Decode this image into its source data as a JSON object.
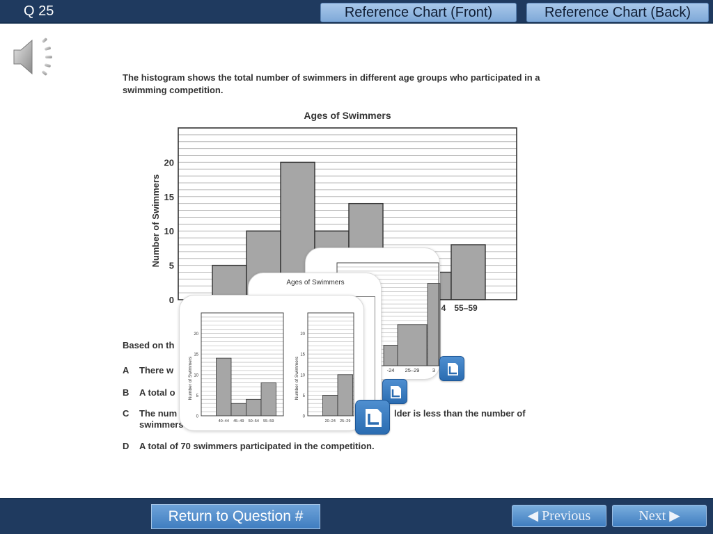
{
  "header": {
    "question_label": "Q 25",
    "ref_front_label": "Reference Chart (Front)",
    "ref_back_label": "Reference Chart (Back)"
  },
  "audio": {
    "icon": "speaker-icon"
  },
  "question": {
    "prompt": "The histogram shows the total number of swimmers in different age groups who participated in a swimming competition.",
    "stem_visible": "Based on th",
    "choices": [
      {
        "letter": "A",
        "fragments": [
          "There w"
        ]
      },
      {
        "letter": "B",
        "fragments": [
          "A total o"
        ]
      },
      {
        "letter": "C",
        "fragments": [
          "The num",
          "lder is less than the number of",
          "swimmers"
        ]
      },
      {
        "letter": "D",
        "fragments": [
          "A total of 70 swimmers participated in the competition."
        ]
      }
    ]
  },
  "chart_data": [
    {
      "type": "bar",
      "title": "Ages of Swimmers",
      "ylabel": "Number of Swimmers",
      "xlabel": "",
      "ylim": [
        0,
        25
      ],
      "yticks": [
        0,
        5,
        10,
        15,
        20
      ],
      "grid": true,
      "visible_categories": [
        "4",
        "55–59"
      ],
      "values": [
        5,
        10,
        20,
        10,
        14,
        5,
        4,
        8
      ]
    },
    {
      "type": "bar",
      "title": "",
      "ylabel": "Number of Swimmers",
      "categories": [
        "40–44",
        "45–49",
        "50–54",
        "55–59"
      ],
      "values": [
        14,
        3,
        4,
        8
      ],
      "ylim": [
        0,
        25
      ],
      "yticks": [
        0,
        5,
        10,
        15,
        20
      ]
    },
    {
      "type": "bar",
      "title": "",
      "ylabel": "Number of Swimmers",
      "categories": [
        "20–24",
        "25–29"
      ],
      "values": [
        5,
        10
      ],
      "ylim": [
        0,
        25
      ],
      "yticks": [
        0,
        5,
        10,
        15,
        20
      ]
    },
    {
      "type": "bar",
      "title": "Ages of Swimmers",
      "visible_categories": [
        "-24",
        "25–29",
        "3"
      ]
    }
  ],
  "print_icon": "print-preview-icon",
  "footer": {
    "return_label": "Return to Question #",
    "previous_label": "◀ Previous",
    "next_label": "Next ▶"
  },
  "colors": {
    "bar_fill": "#a6a6a6",
    "header_bg": "#1f3a5f",
    "button_blue": "#4a86c5"
  }
}
